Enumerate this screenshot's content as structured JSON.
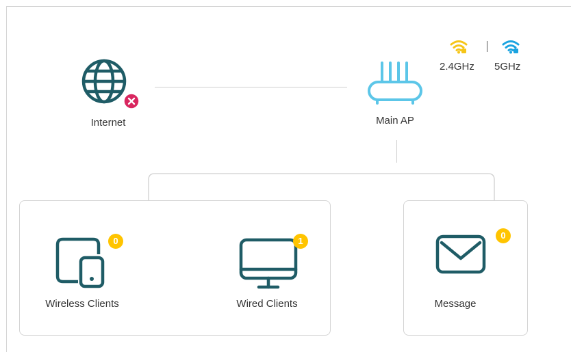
{
  "topology": {
    "internet": {
      "label": "Internet",
      "icon": "globe-icon",
      "status_icon": "disconnected-x-icon",
      "status_color": "#d9265f"
    },
    "main_ap": {
      "label": "Main AP",
      "icon": "router-icon"
    },
    "bands": [
      {
        "label": "2.4GHz",
        "icon": "wifi-icon",
        "color": "#f5c518"
      },
      {
        "label": "5GHz",
        "icon": "wifi-icon",
        "color": "#1aa3e0"
      }
    ]
  },
  "cards": {
    "wireless_clients": {
      "label": "Wireless Clients",
      "count": "0",
      "icon": "devices-icon"
    },
    "wired_clients": {
      "label": "Wired Clients",
      "count": "1",
      "icon": "monitor-icon"
    },
    "message": {
      "label": "Message",
      "count": "0",
      "icon": "envelope-icon"
    }
  },
  "colors": {
    "icon_teal": "#1f5c66",
    "router_blue": "#5cc6e8",
    "badge_yellow": "#ffc400",
    "line_gray": "#cfcfcf"
  }
}
